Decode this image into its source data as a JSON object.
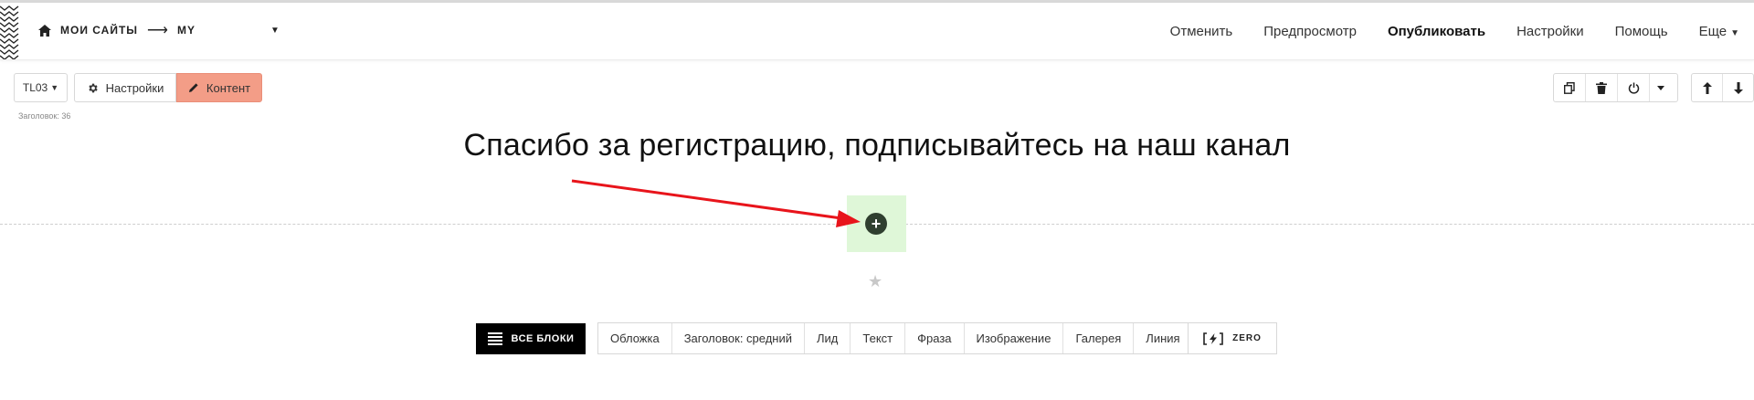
{
  "topbar": {
    "home_label": "МОИ САЙТЫ",
    "arrow": "⟶",
    "site_name": "MY",
    "site_caret": "▼",
    "nav": {
      "cancel": "Отменить",
      "preview": "Предпросмотр",
      "publish": "Опубликовать",
      "settings": "Настройки",
      "help": "Помощь",
      "more": "Еще",
      "more_caret": "▼"
    }
  },
  "block_toolbar": {
    "code": "TL03",
    "code_caret": "▼",
    "settings": "Настройки",
    "content": "Контент",
    "block_label": "Заголовок: 36"
  },
  "content": {
    "headline": "Спасибо за регистрацию, подписывайтесь на наш канал",
    "add_symbol": "+",
    "star": "★"
  },
  "block_library": {
    "all_blocks": "ВСЕ БЛОКИ",
    "types": [
      "Обложка",
      "Заголовок: средний",
      "Лид",
      "Текст",
      "Фраза",
      "Изображение",
      "Галерея",
      "Линия"
    ],
    "zero": "ZERO"
  },
  "colors": {
    "content_button": "#f39d87",
    "add_zone": "#dff7d8",
    "add_button": "#2f3f2f",
    "annotation_arrow": "#e8141b"
  }
}
